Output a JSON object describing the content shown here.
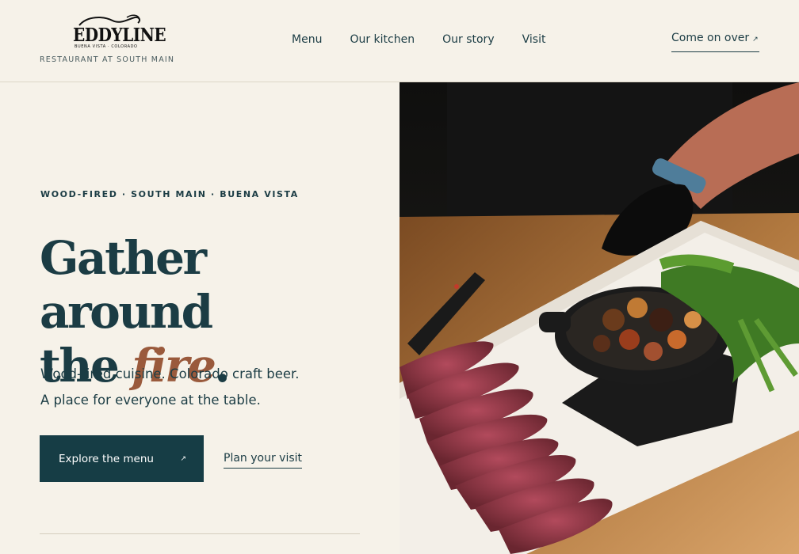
{
  "brand": {
    "logo_word": "EDDYLINE",
    "logo_sub": "BUENA VISTA · COLORADO",
    "tagline": "RESTAURANT AT SOUTH MAIN"
  },
  "nav": {
    "items": [
      {
        "label": "Menu"
      },
      {
        "label": "Our kitchen"
      },
      {
        "label": "Our story"
      },
      {
        "label": "Visit"
      }
    ],
    "cta_label": "Come on over",
    "cta_icon": "arrow-up-right-icon"
  },
  "hero": {
    "eyebrow": "WOOD-FIRED · SOUTH MAIN · BUENA VISTA",
    "headline_line1": "Gather around",
    "headline_line2_prefix": "the ",
    "headline_accent": "fire",
    "headline_suffix": ".",
    "lede_line1": "Wood-fired cuisine. Colorado craft beer.",
    "lede_line2": "A place for everyone at the table.",
    "primary_button": "Explore the menu",
    "primary_button_icon": "arrow-up-right-icon",
    "secondary_link": "Plan your visit"
  },
  "colors": {
    "background": "#f6f2e9",
    "ink": "#1b3c44",
    "accent": "#9a5a3c",
    "button_bg": "#163d45"
  }
}
